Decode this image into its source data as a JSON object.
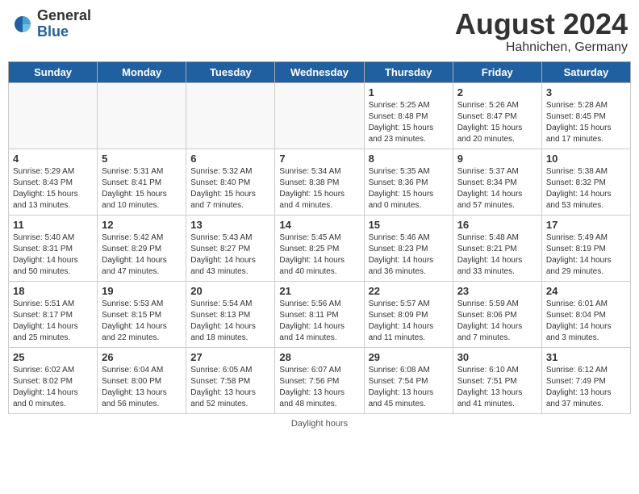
{
  "header": {
    "logo_general": "General",
    "logo_blue": "Blue",
    "month_year": "August 2024",
    "location": "Hahnichen, Germany"
  },
  "days_of_week": [
    "Sunday",
    "Monday",
    "Tuesday",
    "Wednesday",
    "Thursday",
    "Friday",
    "Saturday"
  ],
  "weeks": [
    [
      {
        "num": "",
        "sunrise": "",
        "sunset": "",
        "daylight": "",
        "empty": true
      },
      {
        "num": "",
        "sunrise": "",
        "sunset": "",
        "daylight": "",
        "empty": true
      },
      {
        "num": "",
        "sunrise": "",
        "sunset": "",
        "daylight": "",
        "empty": true
      },
      {
        "num": "",
        "sunrise": "",
        "sunset": "",
        "daylight": "",
        "empty": true
      },
      {
        "num": "1",
        "sunrise": "5:25 AM",
        "sunset": "8:48 PM",
        "daylight": "15 hours and 23 minutes."
      },
      {
        "num": "2",
        "sunrise": "5:26 AM",
        "sunset": "8:47 PM",
        "daylight": "15 hours and 20 minutes."
      },
      {
        "num": "3",
        "sunrise": "5:28 AM",
        "sunset": "8:45 PM",
        "daylight": "15 hours and 17 minutes."
      }
    ],
    [
      {
        "num": "4",
        "sunrise": "5:29 AM",
        "sunset": "8:43 PM",
        "daylight": "15 hours and 13 minutes."
      },
      {
        "num": "5",
        "sunrise": "5:31 AM",
        "sunset": "8:41 PM",
        "daylight": "15 hours and 10 minutes."
      },
      {
        "num": "6",
        "sunrise": "5:32 AM",
        "sunset": "8:40 PM",
        "daylight": "15 hours and 7 minutes."
      },
      {
        "num": "7",
        "sunrise": "5:34 AM",
        "sunset": "8:38 PM",
        "daylight": "15 hours and 4 minutes."
      },
      {
        "num": "8",
        "sunrise": "5:35 AM",
        "sunset": "8:36 PM",
        "daylight": "15 hours and 0 minutes."
      },
      {
        "num": "9",
        "sunrise": "5:37 AM",
        "sunset": "8:34 PM",
        "daylight": "14 hours and 57 minutes."
      },
      {
        "num": "10",
        "sunrise": "5:38 AM",
        "sunset": "8:32 PM",
        "daylight": "14 hours and 53 minutes."
      }
    ],
    [
      {
        "num": "11",
        "sunrise": "5:40 AM",
        "sunset": "8:31 PM",
        "daylight": "14 hours and 50 minutes."
      },
      {
        "num": "12",
        "sunrise": "5:42 AM",
        "sunset": "8:29 PM",
        "daylight": "14 hours and 47 minutes."
      },
      {
        "num": "13",
        "sunrise": "5:43 AM",
        "sunset": "8:27 PM",
        "daylight": "14 hours and 43 minutes."
      },
      {
        "num": "14",
        "sunrise": "5:45 AM",
        "sunset": "8:25 PM",
        "daylight": "14 hours and 40 minutes."
      },
      {
        "num": "15",
        "sunrise": "5:46 AM",
        "sunset": "8:23 PM",
        "daylight": "14 hours and 36 minutes."
      },
      {
        "num": "16",
        "sunrise": "5:48 AM",
        "sunset": "8:21 PM",
        "daylight": "14 hours and 33 minutes."
      },
      {
        "num": "17",
        "sunrise": "5:49 AM",
        "sunset": "8:19 PM",
        "daylight": "14 hours and 29 minutes."
      }
    ],
    [
      {
        "num": "18",
        "sunrise": "5:51 AM",
        "sunset": "8:17 PM",
        "daylight": "14 hours and 25 minutes."
      },
      {
        "num": "19",
        "sunrise": "5:53 AM",
        "sunset": "8:15 PM",
        "daylight": "14 hours and 22 minutes."
      },
      {
        "num": "20",
        "sunrise": "5:54 AM",
        "sunset": "8:13 PM",
        "daylight": "14 hours and 18 minutes."
      },
      {
        "num": "21",
        "sunrise": "5:56 AM",
        "sunset": "8:11 PM",
        "daylight": "14 hours and 14 minutes."
      },
      {
        "num": "22",
        "sunrise": "5:57 AM",
        "sunset": "8:09 PM",
        "daylight": "14 hours and 11 minutes."
      },
      {
        "num": "23",
        "sunrise": "5:59 AM",
        "sunset": "8:06 PM",
        "daylight": "14 hours and 7 minutes."
      },
      {
        "num": "24",
        "sunrise": "6:01 AM",
        "sunset": "8:04 PM",
        "daylight": "14 hours and 3 minutes."
      }
    ],
    [
      {
        "num": "25",
        "sunrise": "6:02 AM",
        "sunset": "8:02 PM",
        "daylight": "14 hours and 0 minutes."
      },
      {
        "num": "26",
        "sunrise": "6:04 AM",
        "sunset": "8:00 PM",
        "daylight": "13 hours and 56 minutes."
      },
      {
        "num": "27",
        "sunrise": "6:05 AM",
        "sunset": "7:58 PM",
        "daylight": "13 hours and 52 minutes."
      },
      {
        "num": "28",
        "sunrise": "6:07 AM",
        "sunset": "7:56 PM",
        "daylight": "13 hours and 48 minutes."
      },
      {
        "num": "29",
        "sunrise": "6:08 AM",
        "sunset": "7:54 PM",
        "daylight": "13 hours and 45 minutes."
      },
      {
        "num": "30",
        "sunrise": "6:10 AM",
        "sunset": "7:51 PM",
        "daylight": "13 hours and 41 minutes."
      },
      {
        "num": "31",
        "sunrise": "6:12 AM",
        "sunset": "7:49 PM",
        "daylight": "13 hours and 37 minutes."
      }
    ]
  ],
  "footer": {
    "daylight_label": "Daylight hours"
  }
}
